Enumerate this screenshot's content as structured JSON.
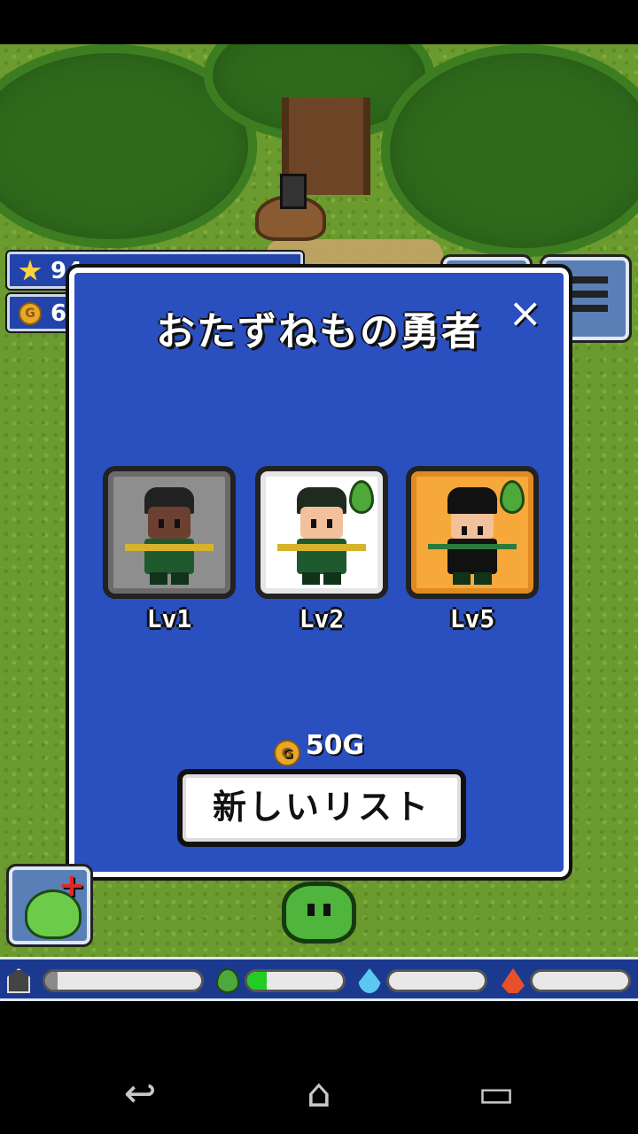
{
  "hud": {
    "stars": "94",
    "gold": "6G"
  },
  "dialog": {
    "title": "おたずねもの勇者",
    "close_label": "×",
    "heroes": [
      {
        "level_label": "Lv1",
        "card_style": "grey",
        "has_leaf": false
      },
      {
        "level_label": "Lv2",
        "card_style": "white",
        "has_leaf": true
      },
      {
        "level_label": "Lv5",
        "card_style": "orange",
        "has_leaf": true
      }
    ],
    "cost": "50G",
    "coin_symbol": "G",
    "new_list_button": "新しいリスト"
  },
  "gauges": [
    {
      "icon": "house-icon",
      "fill": 0.08,
      "color": "#8a8a8a"
    },
    {
      "icon": "grass-icon",
      "fill": 0.2,
      "color": "#22cc22"
    },
    {
      "icon": "water-icon",
      "fill": 0.0,
      "color": "#5ec7f0"
    },
    {
      "icon": "fire-icon",
      "fill": 0.0,
      "color": "#e8502a"
    }
  ],
  "add_button": {
    "plus": "+"
  },
  "nav": {
    "back": "↩",
    "home": "⌂",
    "recents": "▭"
  },
  "colors": {
    "dialog_bg": "#2a4fbf",
    "accent_orange": "#f7a83a"
  }
}
